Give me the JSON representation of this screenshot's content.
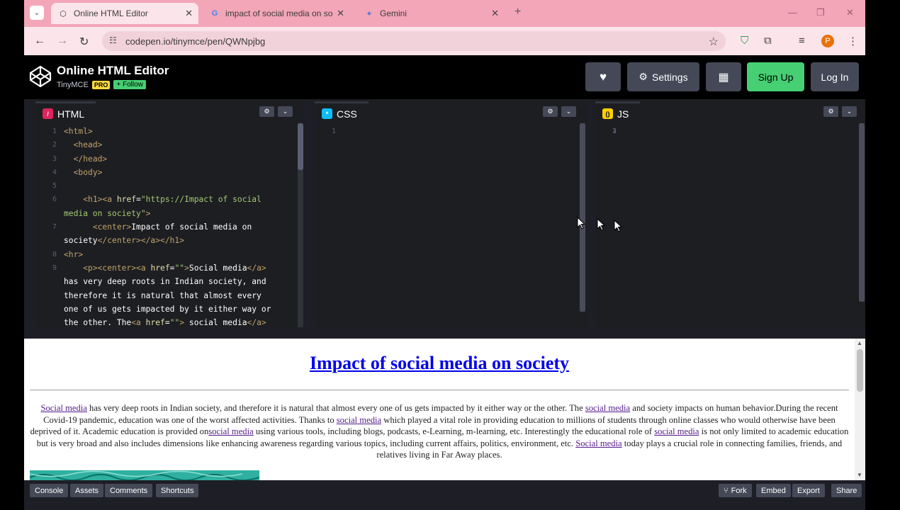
{
  "browser": {
    "tabs": [
      {
        "title": "Online HTML Editor",
        "active": true
      },
      {
        "title": "impact of social media on soci",
        "active": false
      },
      {
        "title": "Gemini",
        "active": false
      }
    ],
    "url": "codepen.io/tinymce/pen/QWNpjbg",
    "profile_initial": "P"
  },
  "header": {
    "title": "Online HTML Editor",
    "owner": "TinyMCE",
    "pro_badge": "PRO",
    "follow_label": "+ Follow",
    "settings_label": "Settings",
    "signup_label": "Sign Up",
    "login_label": "Log In"
  },
  "editors": {
    "html_label": "HTML",
    "css_label": "CSS",
    "js_label": "JS"
  },
  "preview": {
    "heading": "Impact of social media on society",
    "link_text": "social media",
    "link_text_cap": "Social media"
  },
  "bottombar": {
    "console": "Console",
    "assets": "Assets",
    "comments": "Comments",
    "shortcuts": "Shortcuts",
    "fork": "Fork",
    "embed": "Embed",
    "export": "Export",
    "share": "Share"
  },
  "colors": {
    "codepen_green": "#47cf73",
    "pro_yellow": "#ffdd40",
    "tabstrip_pink": "#f3a6b8"
  }
}
